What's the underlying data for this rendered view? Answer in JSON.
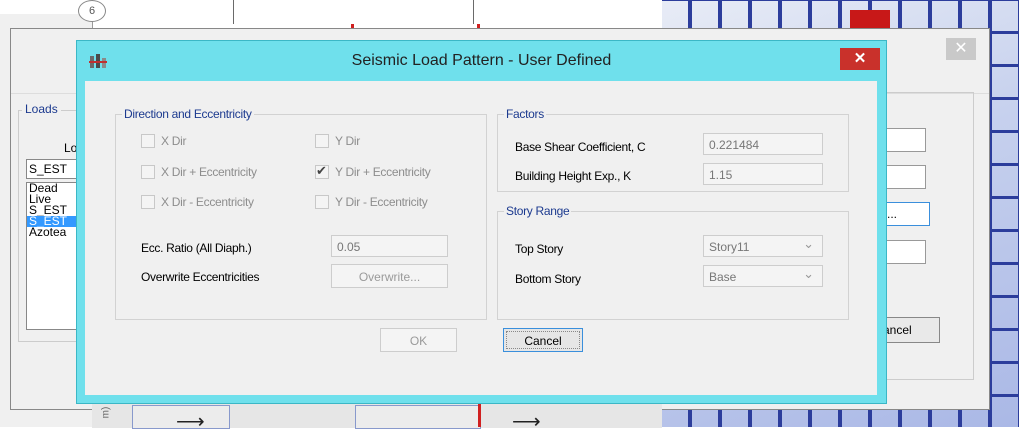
{
  "background": {
    "grid_bubble": "6",
    "loads_group_title": "Loads",
    "loads_label": "Lo",
    "load_case_input": "S_EST",
    "load_list": [
      "Dead",
      "Live",
      "S_EST",
      "S_EST",
      "Azotea"
    ],
    "selected_load_index": 3,
    "right_box_text": "...",
    "cancel_label": "ancel",
    "close_glyph": "✕",
    "arrow_left_glyph": "⟶",
    "arrow_right_glyph": "⟶",
    "rotated_text": "m)"
  },
  "dialog": {
    "title": "Seismic Load Pattern - User Defined",
    "close_glyph": "✕",
    "icon": "app-icon",
    "title_bar_color": "#6fe0ec",
    "direction": {
      "title": "Direction and Eccentricity",
      "checkboxes": [
        {
          "label": "X Dir",
          "checked": false
        },
        {
          "label": "Y Dir",
          "checked": false
        },
        {
          "label": "X Dir + Eccentricity",
          "checked": false
        },
        {
          "label": "Y Dir + Eccentricity",
          "checked": true
        },
        {
          "label": "X Dir - Eccentricity",
          "checked": false
        },
        {
          "label": "Y Dir - Eccentricity",
          "checked": false
        }
      ],
      "ecc_ratio_label": "Ecc. Ratio (All Diaph.)",
      "ecc_ratio_value": "0.05",
      "overwrite_label": "Overwrite Eccentricities",
      "overwrite_button": "Overwrite..."
    },
    "factors": {
      "title": "Factors",
      "base_shear_label": "Base Shear Coefficient, C",
      "base_shear_value": "0.221484",
      "height_exp_label": "Building Height Exp., K",
      "height_exp_value": "1.15"
    },
    "story_range": {
      "title": "Story Range",
      "top_label": "Top Story",
      "top_value": "Story11",
      "bottom_label": "Bottom Story",
      "bottom_value": "Base"
    },
    "ok_button": "OK",
    "cancel_button": "Cancel"
  }
}
